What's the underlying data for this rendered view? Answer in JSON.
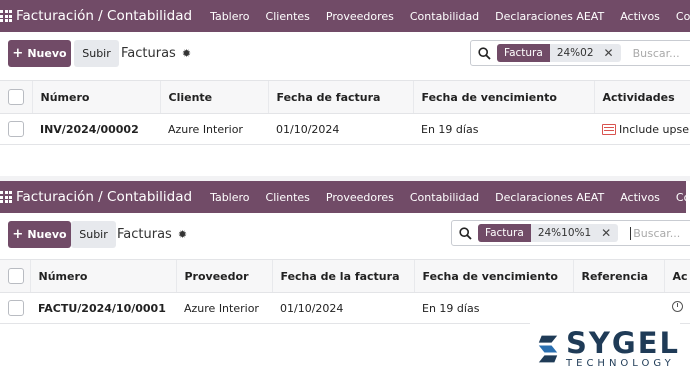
{
  "top": {
    "brand": "Facturación / Contabilidad",
    "menu": [
      "Tablero",
      "Clientes",
      "Proveedores",
      "Contabilidad",
      "Declaraciones AEAT",
      "Activos",
      "Comision"
    ],
    "new_label": "Nuevo",
    "upload_label": "Subir",
    "title": "Facturas",
    "search": {
      "facet_key": "Factura",
      "facet_value": "24%02",
      "placeholder": "Buscar..."
    },
    "columns": [
      "Número",
      "Cliente",
      "Fecha de factura",
      "Fecha de vencimiento",
      "Actividades"
    ],
    "rows": [
      {
        "number": "INV/2024/00002",
        "partner": "Azure Interior",
        "date": "01/10/2024",
        "due": "En 19 días",
        "activity": "Include upsell"
      }
    ]
  },
  "bottom": {
    "brand": "Facturación / Contabilidad",
    "menu": [
      "Tablero",
      "Clientes",
      "Proveedores",
      "Contabilidad",
      "Declaraciones AEAT",
      "Activos",
      "Comisiones"
    ],
    "new_label": "Nuevo",
    "upload_label": "Subir",
    "title": "Facturas",
    "search": {
      "facet_key": "Factura",
      "facet_value": "24%10%1",
      "placeholder": "Buscar..."
    },
    "columns": [
      "Número",
      "Proveedor",
      "Fecha de la factura",
      "Fecha de vencimiento",
      "Referencia",
      "Ac"
    ],
    "rows": [
      {
        "number": "FACTU/2024/10/0001",
        "partner": "Azure Interior",
        "date": "01/10/2024",
        "due": "En 19 días",
        "reference": ""
      }
    ]
  },
  "watermark": {
    "name": "SYGEL",
    "tagline": "TECHNOLOGY"
  },
  "colors": {
    "primary": "#714b67",
    "activity_icon": "#d9534f"
  },
  "icons": {
    "apps": "apps-grid-icon",
    "plus": "plus-icon",
    "gear": "gear-icon",
    "search": "search-icon",
    "remove": "close-icon",
    "activity": "activity-list-icon",
    "clock": "clock-icon"
  }
}
